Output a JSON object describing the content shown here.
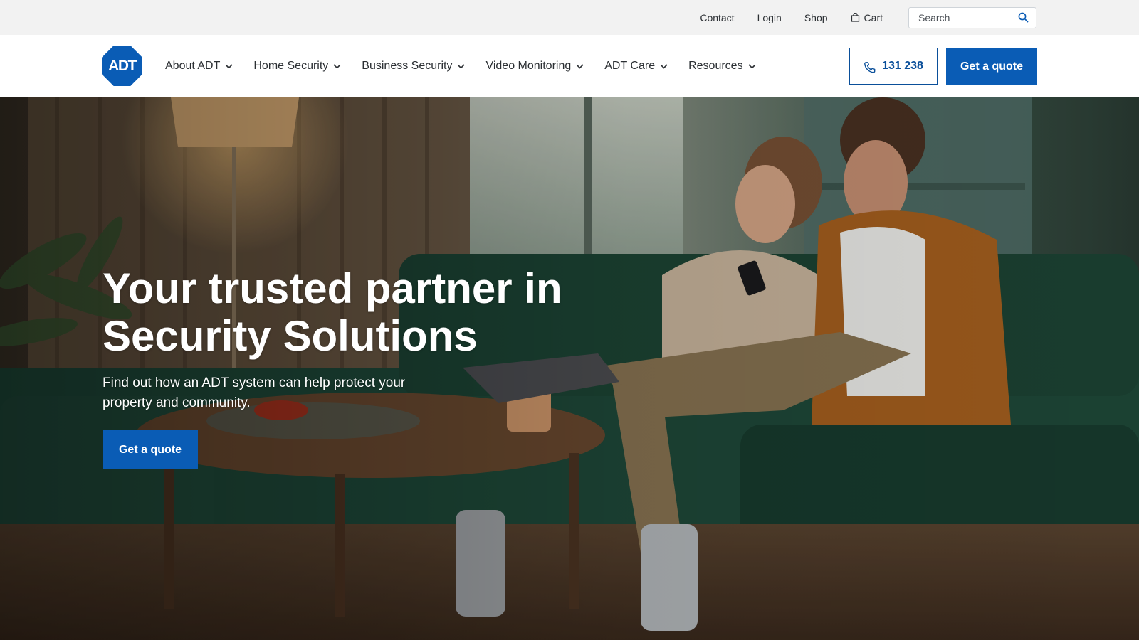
{
  "utility": {
    "links": [
      "Contact",
      "Login",
      "Shop"
    ],
    "cart_label": "Cart",
    "search_placeholder": "Search"
  },
  "brand": {
    "logo_text": "ADT",
    "color": "#0a5cb5"
  },
  "nav": {
    "items": [
      "About ADT",
      "Home Security",
      "Business Security",
      "Video Monitoring",
      "ADT Care",
      "Resources"
    ],
    "phone_label": "131 238",
    "quote_label": "Get a quote"
  },
  "hero": {
    "title": "Your trusted partner in Security Solutions",
    "subtitle": "Find out how an ADT system can help protect your property and community.",
    "cta_label": "Get a quote"
  },
  "colors": {
    "primary_blue": "#0a5cb5",
    "utility_bg": "#f2f2f2"
  }
}
